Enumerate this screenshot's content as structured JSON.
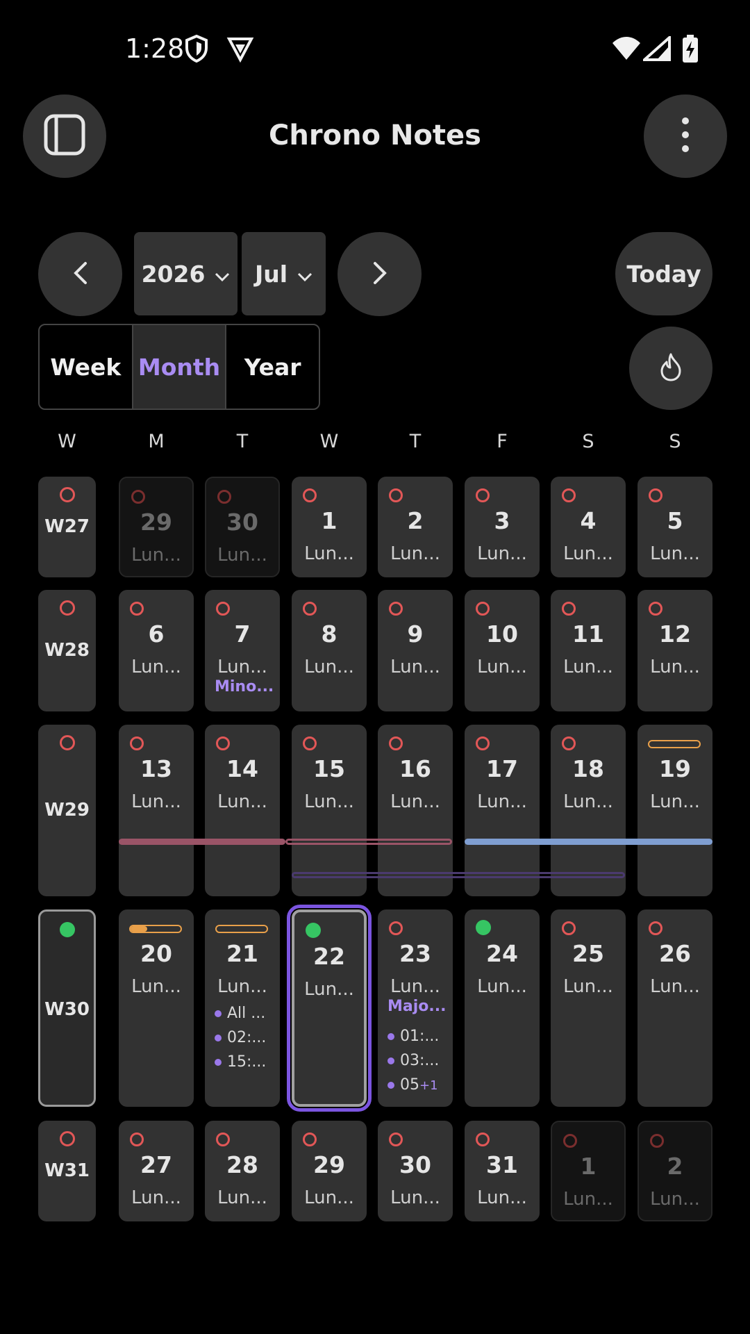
{
  "status": {
    "time": "1:28"
  },
  "app": {
    "title": "Chrono Notes"
  },
  "nav": {
    "year": "2026",
    "month": "Jul",
    "today_label": "Today"
  },
  "views": [
    {
      "label": "Week",
      "active": false
    },
    {
      "label": "Month",
      "active": true
    },
    {
      "label": "Year",
      "active": false
    }
  ],
  "weekday_headers": [
    "W",
    "M",
    "T",
    "W",
    "T",
    "F",
    "S",
    "S"
  ],
  "weeks": [
    {
      "label": "W27",
      "days": [
        {
          "num": "29",
          "lun": "Lun...",
          "dim": true
        },
        {
          "num": "30",
          "lun": "Lun...",
          "dim": true
        },
        {
          "num": "1",
          "lun": "Lun..."
        },
        {
          "num": "2",
          "lun": "Lun..."
        },
        {
          "num": "3",
          "lun": "Lun..."
        },
        {
          "num": "4",
          "lun": "Lun..."
        },
        {
          "num": "5",
          "lun": "Lun..."
        }
      ]
    },
    {
      "label": "W28",
      "days": [
        {
          "num": "6",
          "lun": "Lun..."
        },
        {
          "num": "7",
          "lun": "Lun...",
          "note": "Mino..."
        },
        {
          "num": "8",
          "lun": "Lun..."
        },
        {
          "num": "9",
          "lun": "Lun..."
        },
        {
          "num": "10",
          "lun": "Lun..."
        },
        {
          "num": "11",
          "lun": "Lun..."
        },
        {
          "num": "12",
          "lun": "Lun..."
        }
      ]
    },
    {
      "label": "W29",
      "days": [
        {
          "num": "13",
          "lun": "Lun..."
        },
        {
          "num": "14",
          "lun": "Lun..."
        },
        {
          "num": "15",
          "lun": "Lun..."
        },
        {
          "num": "16",
          "lun": "Lun..."
        },
        {
          "num": "17",
          "lun": "Lun..."
        },
        {
          "num": "18",
          "lun": "Lun..."
        },
        {
          "num": "19",
          "lun": "Lun...",
          "marker": "pill"
        }
      ]
    },
    {
      "label": "W30",
      "current": true,
      "days": [
        {
          "num": "20",
          "lun": "Lun...",
          "marker": "pill-part"
        },
        {
          "num": "21",
          "lun": "Lun...",
          "marker": "pill",
          "events": [
            "All ...",
            "02:...",
            "15:..."
          ]
        },
        {
          "num": "22",
          "lun": "Lun...",
          "marker": "dot",
          "today": true
        },
        {
          "num": "23",
          "lun": "Lun...",
          "note": "Majo...",
          "events": [
            "01:...",
            "03:...",
            "05"
          ],
          "more": "+1"
        },
        {
          "num": "24",
          "lun": "Lun...",
          "marker": "dot"
        },
        {
          "num": "25",
          "lun": "Lun..."
        },
        {
          "num": "26",
          "lun": "Lun..."
        }
      ]
    },
    {
      "label": "W31",
      "days": [
        {
          "num": "27",
          "lun": "Lun..."
        },
        {
          "num": "28",
          "lun": "Lun..."
        },
        {
          "num": "29",
          "lun": "Lun..."
        },
        {
          "num": "30",
          "lun": "Lun..."
        },
        {
          "num": "31",
          "lun": "Lun..."
        },
        {
          "num": "1",
          "lun": "Lun...",
          "dim": true
        },
        {
          "num": "2",
          "lun": "Lun...",
          "dim": true
        }
      ]
    }
  ],
  "colors": {
    "accent": "#a98cf2",
    "ring": "#e25757",
    "dot": "#36c563",
    "pill": "#e9a04a",
    "bar_pink": "#9a5467",
    "bar_blue": "#7f9ed1",
    "bar_purple": "#4a3a6e"
  }
}
